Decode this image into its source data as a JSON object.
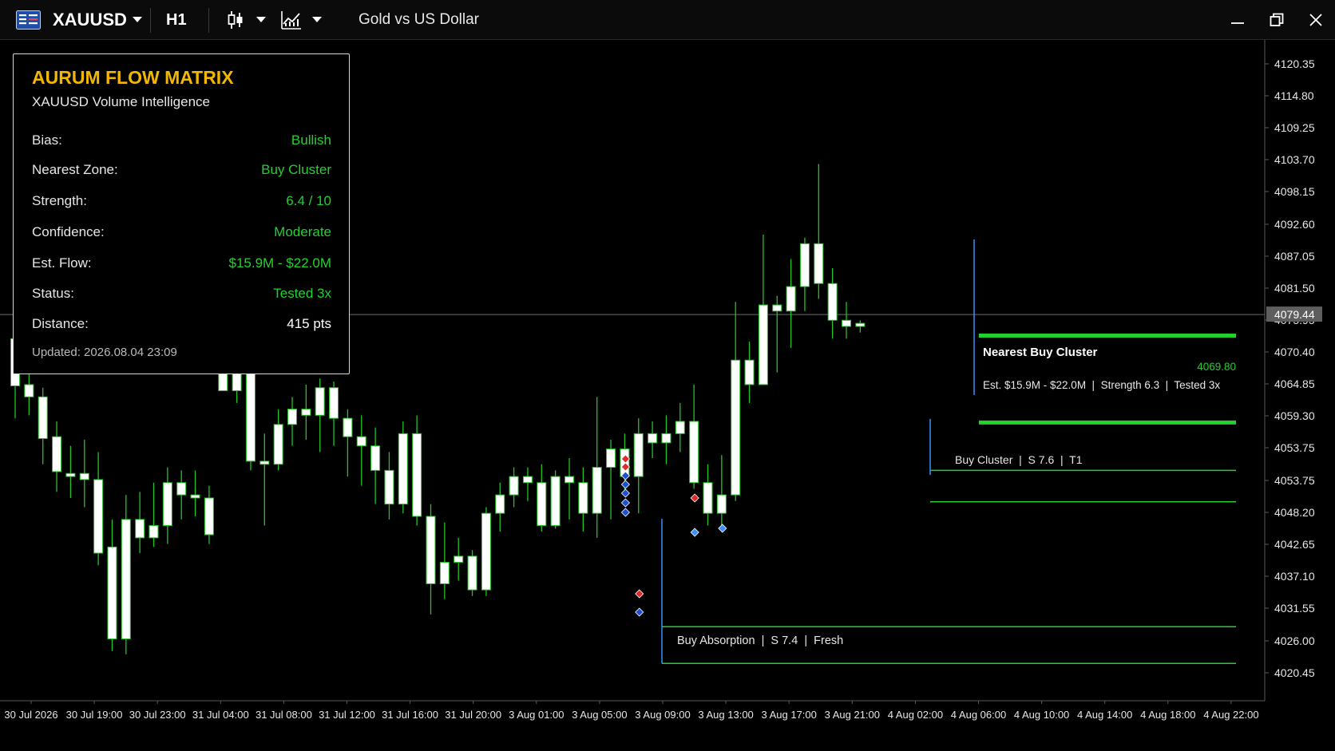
{
  "toolbar": {
    "symbol": "XAUUSD",
    "timeframe": "H1",
    "instrument_name": "Gold vs US Dollar",
    "icons": [
      "chart-menu-icon",
      "dropdown-icon",
      "candlestick-type-icon",
      "indicator-icon",
      "minimize-icon",
      "restore-icon",
      "close-icon"
    ]
  },
  "panel": {
    "title": "AURUM FLOW MATRIX",
    "subtitle": "XAUUSD Volume Intelligence",
    "rows": [
      {
        "label": "Bias:",
        "value": "Bullish"
      },
      {
        "label": "Nearest Zone:",
        "value": "Buy Cluster"
      },
      {
        "label": "Strength:",
        "value": "6.4 / 10"
      },
      {
        "label": "Confidence:",
        "value": "Moderate"
      },
      {
        "label": "Est. Flow:",
        "value": "$15.9M - $22.0M"
      },
      {
        "label": "Status:",
        "value": "Tested 3x"
      },
      {
        "label": "Distance:",
        "value": "415 pts"
      }
    ],
    "updated": "Updated: 2026.08.04 23:09"
  },
  "price_axis": {
    "labels": [
      "4120.35",
      "4114.80",
      "4109.25",
      "4103.70",
      "4098.15",
      "4092.60",
      "4087.05",
      "4081.50",
      "4075.95",
      "4070.40",
      "4064.85",
      "4059.30",
      "4053.75",
      "4053.75",
      "4048.20",
      "4042.65",
      "4037.10",
      "4031.55",
      "4026.00",
      "4020.45"
    ],
    "current_price": "4079.44"
  },
  "time_axis": {
    "labels": [
      "30 Jul 2026",
      "30 Jul 19:00",
      "30 Jul 23:00",
      "31 Jul 04:00",
      "31 Jul 08:00",
      "31 Jul 12:00",
      "31 Jul 16:00",
      "31 Jul 20:00",
      "3 Aug 01:00",
      "3 Aug 05:00",
      "3 Aug 09:00",
      "3 Aug 13:00",
      "3 Aug 17:00",
      "3 Aug 21:00",
      "4 Aug 02:00",
      "4 Aug 06:00",
      "4 Aug 10:00",
      "4 Aug 14:00",
      "4 Aug 18:00",
      "4 Aug 22:00"
    ]
  },
  "zones": {
    "nearest_title": "Nearest Buy Cluster",
    "nearest_price": "4069.80",
    "nearest_details": "Est. $15.9M - $22.0M  |  Strength 6.3  |  Tested 3x",
    "cluster_label": "Buy Cluster  |  S 7.6  |  T1",
    "absorption_label": "Buy Absorption  |  S 7.4  |  Fresh"
  },
  "colors": {
    "accent_gold": "#f2b705",
    "green": "#22d12e",
    "zone_blue": "#3b8fff",
    "candle_up": "#ffffff",
    "wick": "#22c322"
  },
  "chart_data": {
    "type": "candlestick",
    "symbol": "XAUUSD",
    "timeframe": "H1",
    "ylim": [
      4017.0,
      4124.0
    ],
    "candles": [
      [
        4075.5,
        4067.8,
        4076.5,
        4062.5
      ],
      [
        4068.0,
        4066.0,
        4070.0,
        4063.0
      ],
      [
        4066.0,
        4059.2,
        4067.5,
        4055.0
      ],
      [
        4059.5,
        4053.8,
        4062.0,
        4050.5
      ],
      [
        4053.5,
        4053.0,
        4058.0,
        4049.5
      ],
      [
        4053.5,
        4052.5,
        4059.0,
        4048.0
      ],
      [
        4052.5,
        4040.5,
        4057.0,
        4038.5
      ],
      [
        4041.5,
        4026.5,
        4046.0,
        4024.5
      ],
      [
        4026.5,
        4046.0,
        4050.0,
        4024.0
      ],
      [
        4046.0,
        4043.0,
        4050.5,
        4040.5
      ],
      [
        4043.0,
        4045.0,
        4052.0,
        4041.5
      ],
      [
        4045.0,
        4052.0,
        4054.5,
        4042.0
      ],
      [
        4052.0,
        4050.0,
        4054.0,
        4046.0
      ],
      [
        4050.0,
        4049.5,
        4054.0,
        4046.5
      ],
      [
        4049.5,
        4043.5,
        4051.5,
        4042.0
      ],
      [
        4067.0,
        4076.0,
        4082.0,
        4067.0
      ],
      [
        4067.0,
        4074.0,
        4074.5,
        4065.0
      ],
      [
        4074.0,
        4055.5,
        4078.0,
        4054.0
      ],
      [
        4055.5,
        4055.0,
        4060.0,
        4045.0
      ],
      [
        4055.0,
        4061.5,
        4064.0,
        4054.0
      ],
      [
        4061.5,
        4064.0,
        4066.0,
        4058.0
      ],
      [
        4064.0,
        4063.0,
        4068.0,
        4059.0
      ],
      [
        4063.0,
        4067.5,
        4069.0,
        4057.0
      ],
      [
        4067.5,
        4062.5,
        4068.5,
        4058.0
      ],
      [
        4062.5,
        4059.5,
        4064.0,
        4053.0
      ],
      [
        4059.5,
        4058.0,
        4063.0,
        4051.5
      ],
      [
        4058.0,
        4054.0,
        4061.0,
        4048.5
      ],
      [
        4054.0,
        4048.5,
        4057.0,
        4046.0
      ],
      [
        4048.5,
        4060.0,
        4062.0,
        4047.0
      ],
      [
        4060.0,
        4046.5,
        4063.0,
        4045.0
      ],
      [
        4046.5,
        4035.5,
        4048.5,
        4030.5
      ],
      [
        4035.5,
        4039.0,
        4045.5,
        4033.0
      ],
      [
        4039.0,
        4040.0,
        4043.0,
        4036.0
      ],
      [
        4040.0,
        4034.5,
        4041.0,
        4033.5
      ],
      [
        4034.5,
        4047.0,
        4048.0,
        4033.5
      ],
      [
        4047.0,
        4050.0,
        4052.0,
        4044.0
      ],
      [
        4050.0,
        4053.0,
        4054.5,
        4048.0
      ],
      [
        4053.0,
        4052.0,
        4054.5,
        4049.0
      ],
      [
        4052.0,
        4045.0,
        4055.0,
        4044.0
      ],
      [
        4045.0,
        4053.0,
        4054.0,
        4044.5
      ],
      [
        4053.0,
        4052.0,
        4056.0,
        4046.0
      ],
      [
        4052.0,
        4047.0,
        4054.5,
        4044.0
      ],
      [
        4047.0,
        4054.5,
        4066.0,
        4043.0
      ],
      [
        4054.5,
        4057.5,
        4059.0,
        4046.0
      ],
      [
        4057.5,
        4053.0,
        4060.0,
        4050.0
      ],
      [
        4053.0,
        4060.0,
        4062.5,
        4047.0
      ],
      [
        4060.0,
        4058.5,
        4062.0,
        4056.0
      ],
      [
        4058.5,
        4060.0,
        4063.0,
        4055.0
      ],
      [
        4060.0,
        4062.0,
        4065.0,
        4057.0
      ],
      [
        4062.0,
        4052.0,
        4068.0,
        4051.0
      ],
      [
        4052.0,
        4047.0,
        4055.0,
        4045.0
      ],
      [
        4047.0,
        4050.0,
        4056.5,
        4044.0
      ],
      [
        4050.0,
        4072.0,
        4081.5,
        4049.0
      ],
      [
        4072.0,
        4068.0,
        4075.0,
        4065.0
      ],
      [
        4068.0,
        4081.0,
        4092.5,
        4068.0
      ],
      [
        4081.0,
        4080.0,
        4082.5,
        4070.0
      ],
      [
        4080.0,
        4084.0,
        4088.5,
        4074.0
      ],
      [
        4084.0,
        4091.0,
        4092.0,
        4080.0
      ],
      [
        4091.0,
        4084.5,
        4104.0,
        4082.0
      ],
      [
        4084.5,
        4078.5,
        4087.0,
        4075.5
      ],
      [
        4078.5,
        4077.5,
        4081.5,
        4075.5
      ],
      [
        4077.5,
        4078.0,
        4078.5,
        4076.5
      ]
    ],
    "zones": [
      {
        "name": "Nearest Buy Cluster",
        "top": 4076.0,
        "bottom": 4063.0,
        "price": 4069.8
      },
      {
        "name": "Buy Cluster",
        "top": 4054.0,
        "bottom": 4049.0
      },
      {
        "name": "Buy Absorption",
        "top": 4028.5,
        "bottom": 4022.5
      }
    ],
    "current_price": 4079.44
  }
}
